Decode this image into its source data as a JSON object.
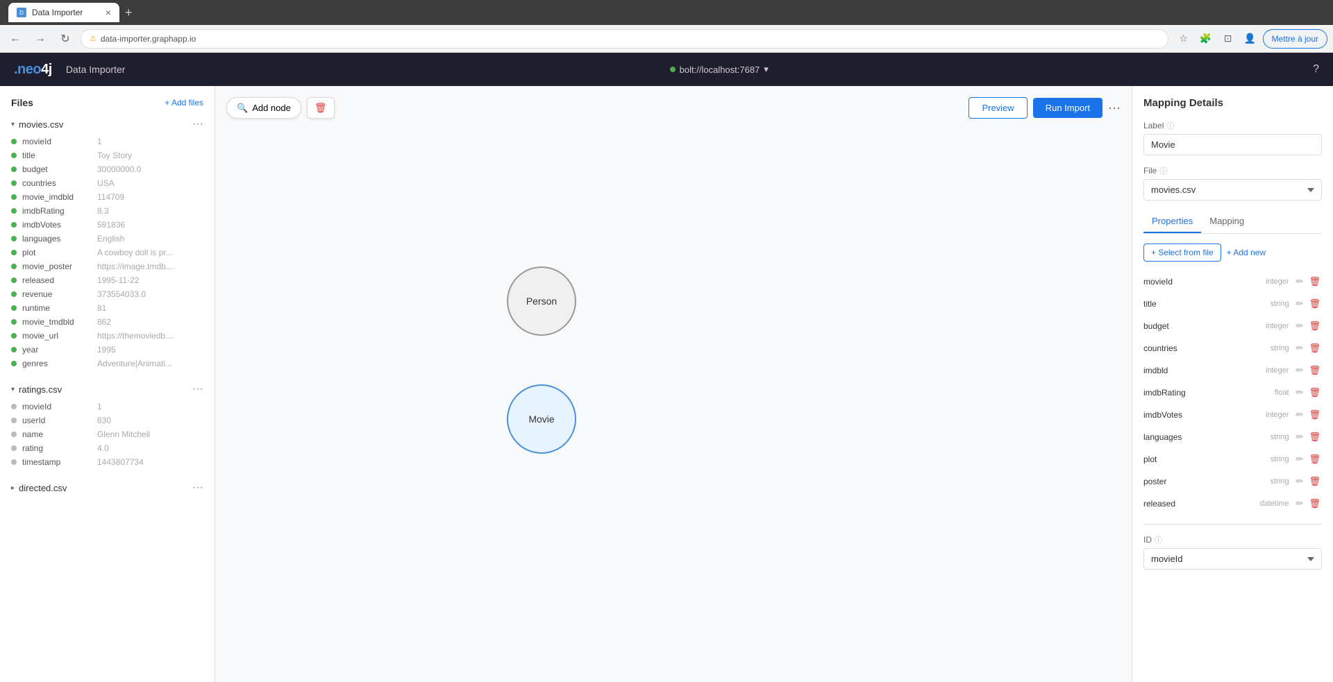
{
  "browser": {
    "tab_title": "Data Importer",
    "tab_close": "×",
    "new_tab": "+",
    "nav_back": "←",
    "nav_forward": "→",
    "nav_refresh": "↻",
    "address_lock": "⚠",
    "address_url": "data-importer.graphapp.io",
    "update_btn": "Mettre à jour"
  },
  "app_header": {
    "logo_neo": ".neo",
    "logo_4j": "4j",
    "title": "Data Importer",
    "connection": "bolt://localhost:7687",
    "help_icon": "?"
  },
  "sidebar": {
    "title": "Files",
    "add_files": "+ Add files",
    "files": [
      {
        "name": "movies.csv",
        "expanded": true,
        "fields": [
          {
            "name": "movieId",
            "value": "1",
            "active": true
          },
          {
            "name": "title",
            "value": "Toy Story",
            "active": true
          },
          {
            "name": "budget",
            "value": "30000000.0",
            "active": true
          },
          {
            "name": "countries",
            "value": "USA",
            "active": true
          },
          {
            "name": "movie_imdbld",
            "value": "114709",
            "active": true
          },
          {
            "name": "imdbRating",
            "value": "8.3",
            "active": true
          },
          {
            "name": "imdbVotes",
            "value": "591836",
            "active": true
          },
          {
            "name": "languages",
            "value": "English",
            "active": true
          },
          {
            "name": "plot",
            "value": "A cowboy doll is pr...",
            "active": true
          },
          {
            "name": "movie_poster",
            "value": "https://image.tmdb....",
            "active": true
          },
          {
            "name": "released",
            "value": "1995-11-22",
            "active": true
          },
          {
            "name": "revenue",
            "value": "373554033.0",
            "active": true
          },
          {
            "name": "runtime",
            "value": "81",
            "active": true
          },
          {
            "name": "movie_tmdbld",
            "value": "862",
            "active": true
          },
          {
            "name": "movie_url",
            "value": "https://themoviedb....",
            "active": true
          },
          {
            "name": "year",
            "value": "1995",
            "active": true
          },
          {
            "name": "genres",
            "value": "Adventure|Animati...",
            "active": true
          }
        ]
      },
      {
        "name": "ratings.csv",
        "expanded": true,
        "fields": [
          {
            "name": "movieId",
            "value": "1",
            "active": false
          },
          {
            "name": "userId",
            "value": "630",
            "active": false
          },
          {
            "name": "name",
            "value": "Glenn Mitchell",
            "active": false
          },
          {
            "name": "rating",
            "value": "4.0",
            "active": false
          },
          {
            "name": "timestamp",
            "value": "1443807734",
            "active": false
          }
        ]
      },
      {
        "name": "directed.csv",
        "expanded": false,
        "fields": []
      }
    ]
  },
  "canvas": {
    "add_node_btn": "Add node",
    "nodes": [
      {
        "id": "person",
        "label": "Person",
        "type": "person"
      },
      {
        "id": "movie",
        "label": "Movie",
        "type": "movie"
      }
    ]
  },
  "import_toolbar": {
    "preview_btn": "Preview",
    "run_btn": "Run Import",
    "more_icon": "···"
  },
  "mapping_panel": {
    "title": "Mapping Details",
    "label_section": {
      "label": "Label",
      "value": "Movie"
    },
    "file_section": {
      "label": "File",
      "value": "movies.csv"
    },
    "tabs": [
      {
        "id": "properties",
        "label": "Properties",
        "active": true
      },
      {
        "id": "mapping",
        "label": "Mapping",
        "active": false
      }
    ],
    "select_from_file": "+ Select from file",
    "add_new": "+ Add new",
    "properties": [
      {
        "name": "movieId",
        "type": "integer"
      },
      {
        "name": "title",
        "type": "string"
      },
      {
        "name": "budget",
        "type": "integer"
      },
      {
        "name": "countries",
        "type": "string"
      },
      {
        "name": "imdbld",
        "type": "integer"
      },
      {
        "name": "imdbRating",
        "type": "float"
      },
      {
        "name": "imdbVotes",
        "type": "integer"
      },
      {
        "name": "languages",
        "type": "string"
      },
      {
        "name": "plot",
        "type": "string"
      },
      {
        "name": "poster",
        "type": "string"
      },
      {
        "name": "released",
        "type": "datetime"
      }
    ],
    "id_section": {
      "label": "ID",
      "value": "movieId"
    }
  }
}
